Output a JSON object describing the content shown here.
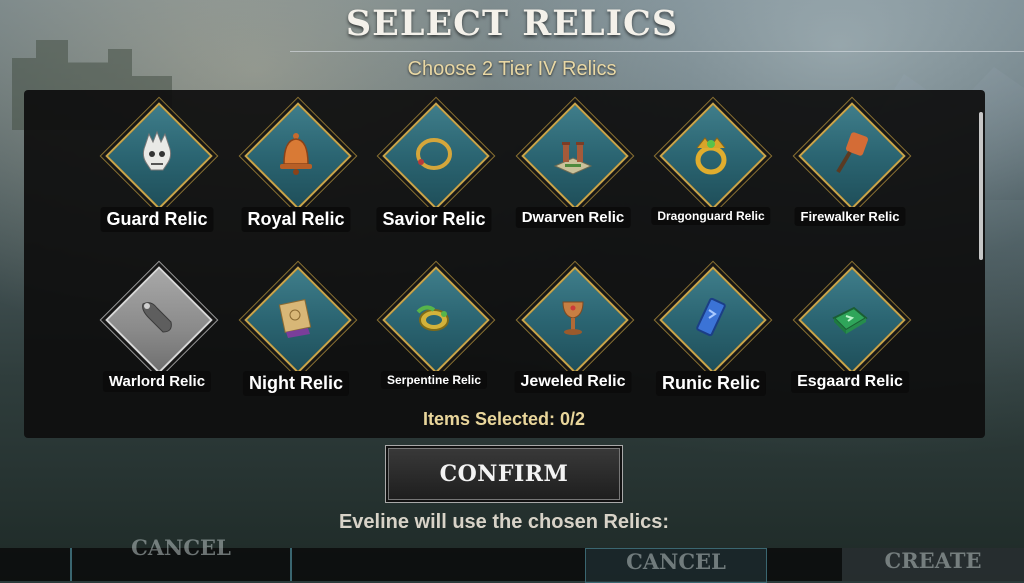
{
  "header": {
    "title": "SELECT RELICS",
    "subtitle": "Choose 2 Tier IV Relics"
  },
  "relics": [
    {
      "name": "Guard Relic",
      "icon": "skull-helm-icon",
      "selected": false,
      "disabled": false
    },
    {
      "name": "Royal Relic",
      "icon": "bell-icon",
      "selected": false,
      "disabled": false
    },
    {
      "name": "Savior Relic",
      "icon": "ring-icon",
      "selected": false,
      "disabled": false
    },
    {
      "name": "Dwarven Relic",
      "icon": "pillars-icon",
      "selected": false,
      "disabled": false
    },
    {
      "name": "Dragonguard Relic",
      "icon": "gold-ring-icon",
      "selected": false,
      "disabled": false
    },
    {
      "name": "Firewalker Relic",
      "icon": "torch-icon",
      "selected": false,
      "disabled": false
    },
    {
      "name": "Warlord Relic",
      "icon": "scroll-tag-icon",
      "selected": false,
      "disabled": true
    },
    {
      "name": "Night Relic",
      "icon": "parchment-icon",
      "selected": false,
      "disabled": false
    },
    {
      "name": "Serpentine Relic",
      "icon": "serpent-bracelet-icon",
      "selected": false,
      "disabled": false
    },
    {
      "name": "Jeweled Relic",
      "icon": "goblet-icon",
      "selected": false,
      "disabled": false
    },
    {
      "name": "Runic Relic",
      "icon": "blue-rune-icon",
      "selected": false,
      "disabled": false
    },
    {
      "name": "Esgaard Relic",
      "icon": "green-tablet-icon",
      "selected": false,
      "disabled": false
    }
  ],
  "selection": {
    "status": "Items Selected: 0/2",
    "selected_count": 0,
    "max": 2
  },
  "actions": {
    "confirm_label": "CONFIRM",
    "info_text": "Eveline will use the chosen Relics:"
  },
  "background_buttons": {
    "left_label": "CANCEL",
    "mid_label": "CANCEL",
    "right_label": "CREATE"
  },
  "colors": {
    "gold_border": "#c9a54a",
    "teal_fill": "#2b6572",
    "subtitle": "#e8d7a4"
  }
}
